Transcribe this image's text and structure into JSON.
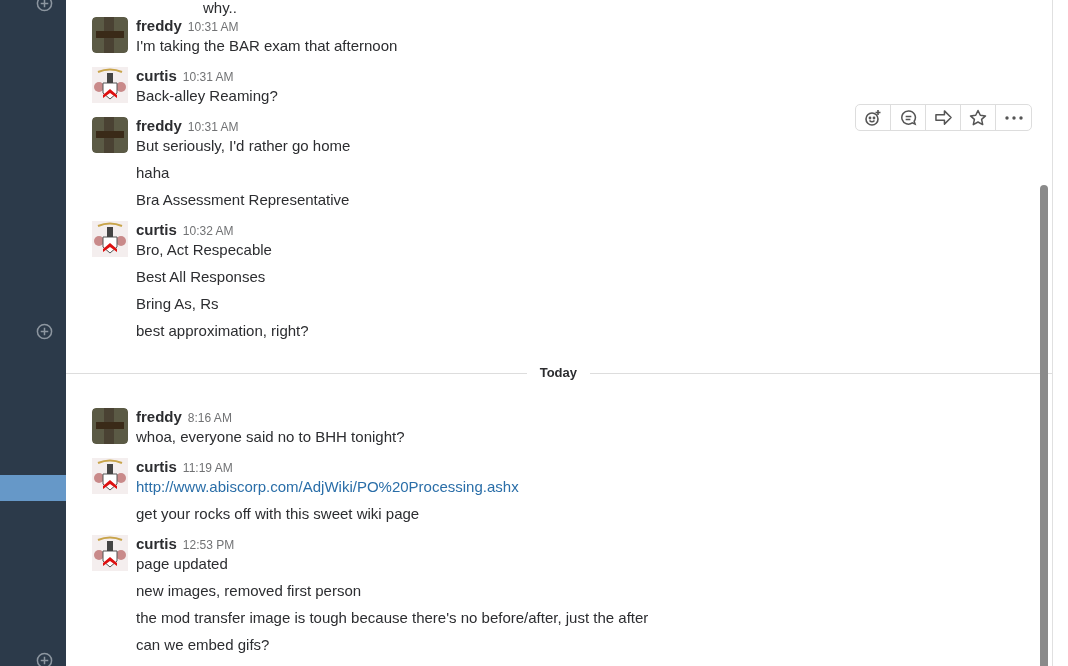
{
  "top_fragment": "why..",
  "feed": [
    {
      "kind": "message_group",
      "author": "freddy",
      "avatar": {
        "kind": "photo"
      },
      "time": "10:31 AM",
      "hovered": false,
      "lines": [
        {
          "kind": "text",
          "text": "I'm taking the BAR exam that afternoon"
        }
      ]
    },
    {
      "kind": "message_group",
      "author": "curtis",
      "avatar": {
        "kind": "crest"
      },
      "time": "10:31 AM",
      "hovered": false,
      "lines": [
        {
          "kind": "text",
          "text": "Back-alley Reaming?"
        }
      ]
    },
    {
      "kind": "message_group",
      "author": "freddy",
      "avatar": {
        "kind": "photo"
      },
      "time": "10:31 AM",
      "hovered": true,
      "lines": [
        {
          "kind": "text",
          "text": "But seriously, I'd rather go home"
        },
        {
          "kind": "text",
          "text": "haha"
        },
        {
          "kind": "text",
          "text": "Bra Assessment Representative"
        }
      ]
    },
    {
      "kind": "message_group",
      "author": "curtis",
      "avatar": {
        "kind": "crest"
      },
      "time": "10:32 AM",
      "hovered": false,
      "lines": [
        {
          "kind": "text",
          "text": "Bro, Act Respecable"
        },
        {
          "kind": "text",
          "text": "Best All Responses"
        },
        {
          "kind": "text",
          "text": "Bring As, Rs"
        },
        {
          "kind": "text",
          "text": "best approximation, right?"
        }
      ]
    },
    {
      "kind": "date_divider",
      "label": "Today"
    },
    {
      "kind": "message_group",
      "author": "freddy",
      "avatar": {
        "kind": "photo"
      },
      "time": "8:16 AM",
      "hovered": false,
      "lines": [
        {
          "kind": "text",
          "text": "whoa, everyone said no to BHH tonight?"
        }
      ]
    },
    {
      "kind": "message_group",
      "author": "curtis",
      "avatar": {
        "kind": "crest"
      },
      "time": "11:19 AM",
      "hovered": false,
      "lines": [
        {
          "kind": "link",
          "text": "http://www.abiscorp.com/AdjWiki/PO%20Processing.ashx"
        },
        {
          "kind": "text",
          "text": "get your rocks off with this sweet wiki page"
        }
      ]
    },
    {
      "kind": "message_group",
      "author": "curtis",
      "avatar": {
        "kind": "crest"
      },
      "time": "12:53 PM",
      "hovered": false,
      "lines": [
        {
          "kind": "text",
          "text": "page updated"
        },
        {
          "kind": "text",
          "text": "new images, removed first person"
        },
        {
          "kind": "text",
          "text": "the mod transfer image is tough because there's no before/after, just the after"
        },
        {
          "kind": "text",
          "text": "can we embed gifs?"
        }
      ]
    }
  ]
}
